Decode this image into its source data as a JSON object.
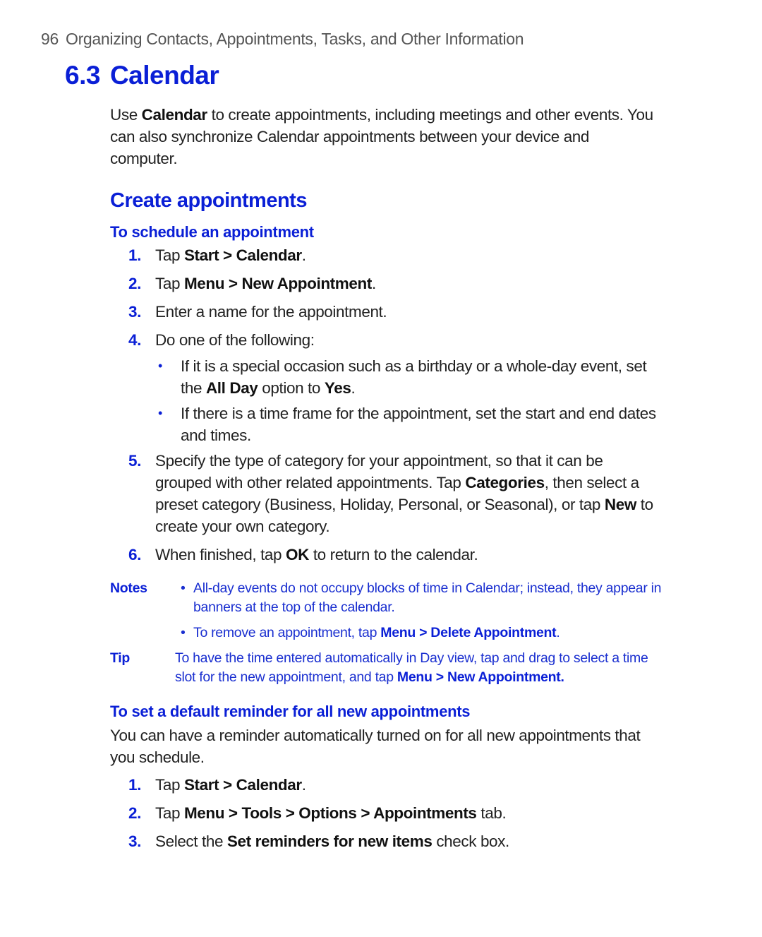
{
  "header": {
    "page_number": "96",
    "chapter_title": "Organizing Contacts, Appointments, Tasks, and Other Information"
  },
  "section": {
    "number": "6.3",
    "title": "Calendar",
    "intro_pre": "Use ",
    "intro_bold": "Calendar",
    "intro_post": " to create appointments, including meetings and other events. You can also synchronize Calendar appointments between your device and computer."
  },
  "create": {
    "heading": "Create appointments",
    "subheading": "To schedule an appointment",
    "steps": [
      {
        "num": "1.",
        "pre": "Tap ",
        "bold": "Start > Calendar",
        "post": "."
      },
      {
        "num": "2.",
        "pre": "Tap ",
        "bold": "Menu > New Appointment",
        "post": "."
      },
      {
        "num": "3.",
        "text": "Enter a name for the appointment."
      },
      {
        "num": "4.",
        "text": "Do one of the following:"
      },
      {
        "num": "5.",
        "pre": "Specify the type of category for your appointment, so that it can be grouped with other related appointments. Tap ",
        "bold": "Categories",
        "mid": ", then select a preset category (Business, Holiday, Personal, or Seasonal), or tap ",
        "bold2": "New",
        "post": " to create your own category."
      },
      {
        "num": "6.",
        "pre": "When finished, tap ",
        "bold": "OK",
        "post": " to return to the calendar."
      }
    ],
    "step4_bullets": [
      {
        "pre": "If it is a special occasion such as a birthday or a whole-day event, set the ",
        "bold": "All Day",
        "mid": " option to ",
        "bold2": "Yes",
        "post": "."
      },
      {
        "text": "If there is a time frame for the appointment, set the start and end dates and times."
      }
    ],
    "notes_label": "Notes",
    "notes": [
      {
        "text": "All-day events do not occupy blocks of time in Calendar; instead, they appear in banners at the top of the calendar."
      },
      {
        "pre": "To remove an appointment, tap ",
        "bold": "Menu > Delete Appointment",
        "post": "."
      }
    ],
    "tip_label": "Tip",
    "tip": {
      "pre": "To have the time entered automatically in Day view, tap and drag to select a time slot for the new appointment, and tap ",
      "bold": "Menu > New Appointment."
    }
  },
  "reminder": {
    "subheading": "To set a default reminder for all new appointments",
    "intro": "You can have a reminder automatically turned on for all new appointments that you schedule.",
    "steps": [
      {
        "num": "1.",
        "pre": "Tap ",
        "bold": "Start > Calendar",
        "post": "."
      },
      {
        "num": "2.",
        "pre": "Tap ",
        "bold": "Menu > Tools > Options > Appointments",
        "post": " tab."
      },
      {
        "num": "3.",
        "pre": "Select the ",
        "bold": "Set reminders for new items",
        "post": " check box."
      }
    ]
  },
  "colors": {
    "heading_blue": "#0a1fd6",
    "body_text": "#222222"
  }
}
